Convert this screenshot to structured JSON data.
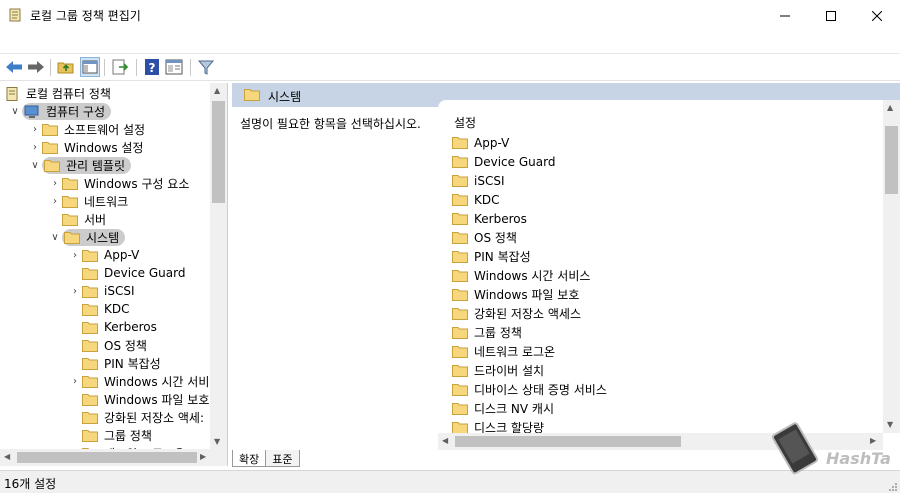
{
  "window": {
    "title": "로컬 그룹 정책 편집기",
    "minimize": "—",
    "maximize": "☐",
    "close": "✕"
  },
  "tree": {
    "root": "로컬 컴퓨터 정책",
    "items": [
      {
        "label": "컴퓨터 구성"
      },
      {
        "label": "소프트웨어 설정"
      },
      {
        "label": "Windows 설정"
      },
      {
        "label": "관리 템플릿"
      },
      {
        "label": "Windows 구성 요소"
      },
      {
        "label": "네트워크"
      },
      {
        "label": "서버"
      },
      {
        "label": "시스템"
      },
      {
        "label": "App-V"
      },
      {
        "label": "Device Guard"
      },
      {
        "label": "iSCSI"
      },
      {
        "label": "KDC"
      },
      {
        "label": "Kerberos"
      },
      {
        "label": "OS 정책"
      },
      {
        "label": "PIN 복잡성"
      },
      {
        "label": "Windows 시간 서비:"
      },
      {
        "label": "Windows 파일 보호"
      },
      {
        "label": "강화된 저장소 액세:"
      },
      {
        "label": "그룹 정책"
      },
      {
        "label": "네트워크 로그온"
      }
    ]
  },
  "right": {
    "header": "시스템",
    "description": "설명이 필요한 항목을 선택하십시오.",
    "column_header": "설정",
    "items": [
      "App-V",
      "Device Guard",
      "iSCSI",
      "KDC",
      "Kerberos",
      "OS 정책",
      "PIN 복잡성",
      "Windows 시간 서비스",
      "Windows 파일 보호",
      "강화된 저장소 액세스",
      "그룹 정책",
      "네트워크 로그온",
      "드라이버 설치",
      "디바이스 상태 증명 서비스",
      "디스크 NV 캐시",
      "디스크 할당량"
    ]
  },
  "tabs": {
    "extended": "확장",
    "standard": "표준"
  },
  "status": {
    "text": "16개 설정"
  },
  "watermark": {
    "text": "HashTag"
  }
}
